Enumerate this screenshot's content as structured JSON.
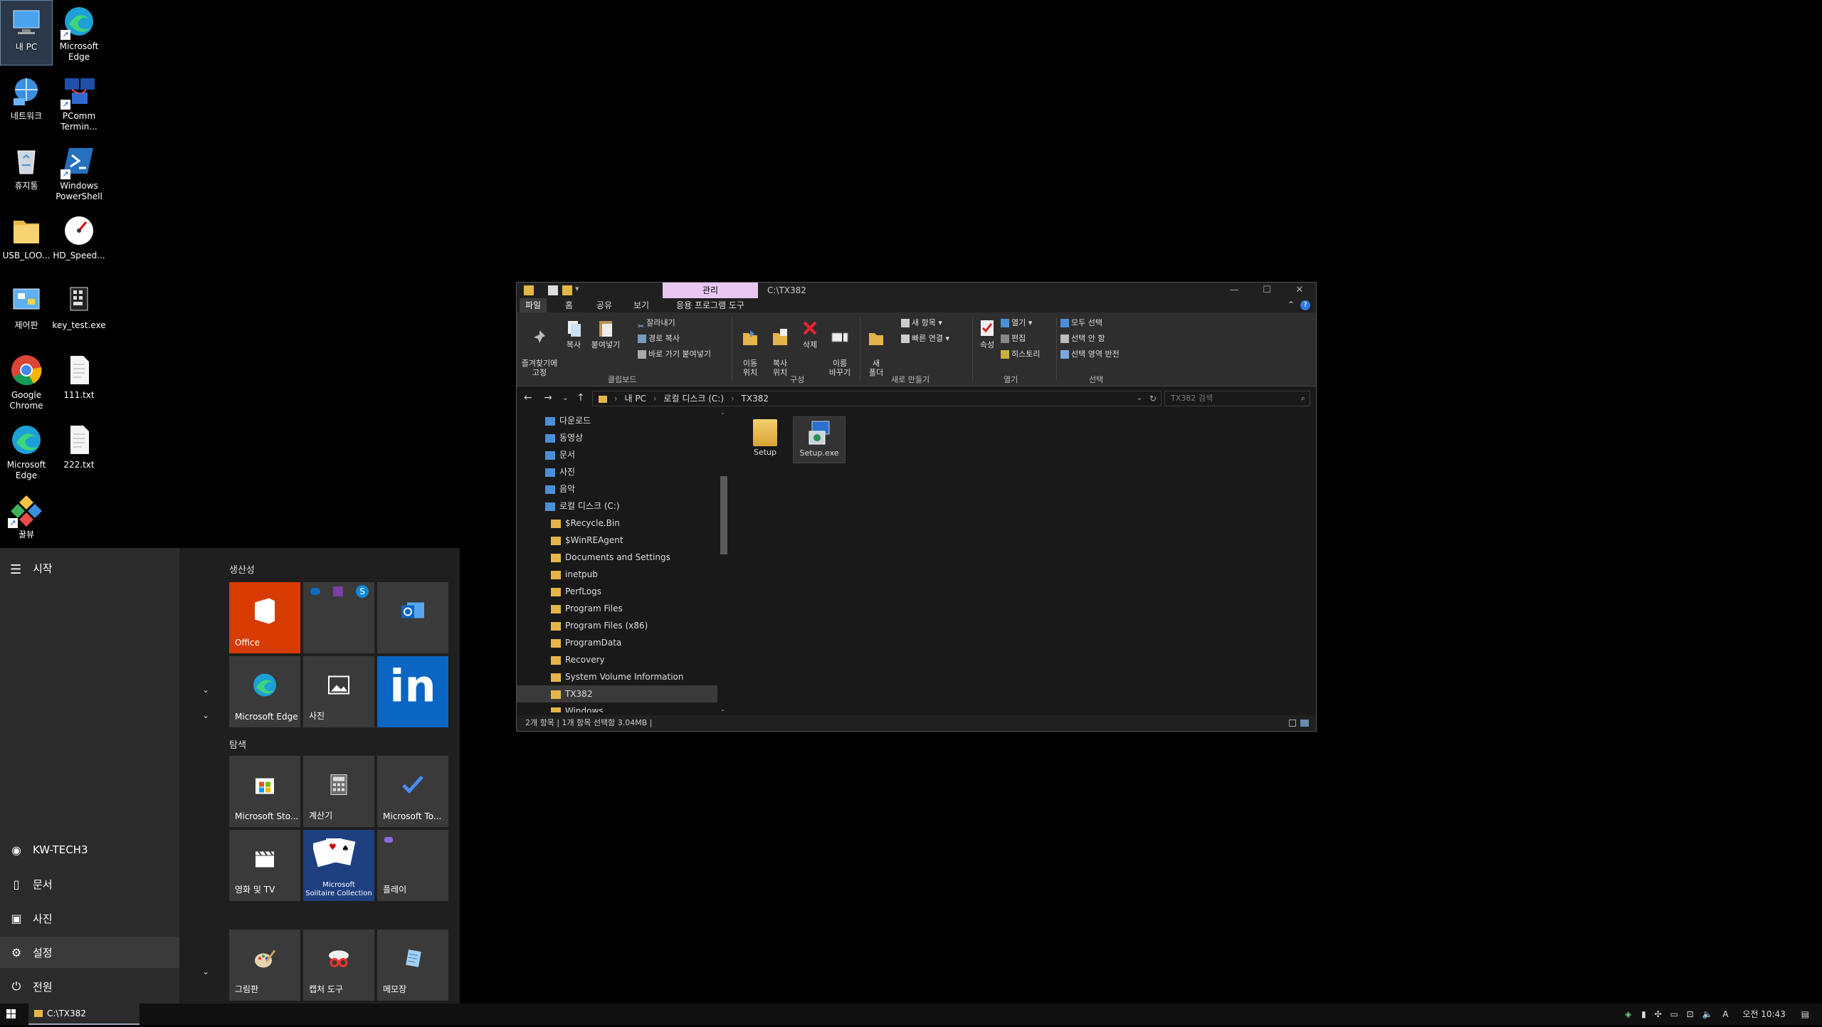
{
  "desktop": {
    "icons": [
      {
        "label": "내 PC",
        "icon": "this-pc-icon"
      },
      {
        "label": "Microsoft\nEdge",
        "icon": "edge-icon"
      },
      {
        "label": "네트워크",
        "icon": "network-icon"
      },
      {
        "label": "PComm\nTermin...",
        "icon": "pcomm-terminal-icon"
      },
      {
        "label": "휴지통",
        "icon": "recycle-bin-icon"
      },
      {
        "label": "Windows\nPowerShell",
        "icon": "powershell-icon"
      },
      {
        "label": "USB_LOO...",
        "icon": "folder-icon"
      },
      {
        "label": "HD_Speed...",
        "icon": "hd-speed-icon"
      },
      {
        "label": "제어판",
        "icon": "control-panel-icon"
      },
      {
        "label": "key_test.exe",
        "icon": "keyboard-app-icon"
      },
      {
        "label": "Google\nChrome",
        "icon": "chrome-icon"
      },
      {
        "label": "111.txt",
        "icon": "text-file-icon"
      },
      {
        "label": "Microsoft\nEdge",
        "icon": "edge-icon"
      },
      {
        "label": "222.txt",
        "icon": "text-file-icon"
      },
      {
        "label": "꿀뷰",
        "icon": "honeyview-icon"
      }
    ]
  },
  "start_menu": {
    "title": "시작",
    "nav": {
      "user": "KW-TECH3",
      "documents": "문서",
      "pictures": "사진",
      "settings": "설정",
      "power": "전원"
    },
    "groups": {
      "productivity": "생산성",
      "explore": "탐색"
    },
    "tiles": {
      "office": "Office",
      "edge": "Microsoft Edge",
      "photos": "사진",
      "store": "Microsoft Sto...",
      "calculator": "계산기",
      "todo": "Microsoft To...",
      "movies": "영화 및 TV",
      "solitaire": "Microsoft\nSolitaire Collection",
      "play": "플레이",
      "paint": "그림판",
      "snipping": "캡처 도구",
      "notepad": "메모장"
    }
  },
  "explorer": {
    "manage_tab": "관리",
    "title": "C:\\TX382",
    "tabs": {
      "file": "파일",
      "home": "홈",
      "share": "공유",
      "view": "보기",
      "app_tools": "응용 프로그램 도구"
    },
    "ribbon": {
      "pin": "즐겨찾기에\n고정",
      "copy": "복사",
      "paste": "붙여넣기",
      "cut": "잘라내기",
      "copy_path": "경로 복사",
      "paste_shortcut": "바로 가기 붙여넣기",
      "clipboard": "클립보드",
      "move_to": "이동\n위치",
      "copy_to": "복사\n위치",
      "delete": "삭제",
      "rename": "이름\n바꾸기",
      "organize": "구성",
      "new_folder": "새\n폴더",
      "new_item": "새 항목",
      "easy_access": "빠른 연결",
      "new": "새로 만들기",
      "properties": "속성",
      "open": "열기",
      "edit": "편집",
      "history": "히스토리",
      "open_group": "열기",
      "select_all": "모두 선택",
      "select_none": "선택 안 함",
      "invert_selection": "선택 영역 반전",
      "select": "선택"
    },
    "address": {
      "crumbs": [
        "내 PC",
        "로컬 디스크 (C:)",
        "TX382"
      ],
      "search_placeholder": "TX382 검색"
    },
    "tree": [
      {
        "label": "다운로드",
        "indent": 1
      },
      {
        "label": "동영상",
        "indent": 1
      },
      {
        "label": "문서",
        "indent": 1
      },
      {
        "label": "사진",
        "indent": 1
      },
      {
        "label": "음악",
        "indent": 1
      },
      {
        "label": "로컬 디스크 (C:)",
        "indent": 1
      },
      {
        "label": "$Recycle.Bin",
        "indent": 2
      },
      {
        "label": "$WinREAgent",
        "indent": 2
      },
      {
        "label": "Documents and Settings",
        "indent": 2
      },
      {
        "label": "inetpub",
        "indent": 2
      },
      {
        "label": "PerfLogs",
        "indent": 2
      },
      {
        "label": "Program Files",
        "indent": 2
      },
      {
        "label": "Program Files (x86)",
        "indent": 2
      },
      {
        "label": "ProgramData",
        "indent": 2
      },
      {
        "label": "Recovery",
        "indent": 2
      },
      {
        "label": "System Volume Information",
        "indent": 2
      },
      {
        "label": "TX382",
        "indent": 2
      },
      {
        "label": "Windows",
        "indent": 2
      }
    ],
    "files": [
      {
        "name": "Setup",
        "type": "folder"
      },
      {
        "name": "Setup.exe",
        "type": "exe"
      }
    ],
    "status": "2개 항목  |  1개 항목 선택함 3.04MB  |"
  },
  "taskbar": {
    "explorer_label": "C:\\TX382",
    "time": "오전 10:43",
    "ime": "A"
  },
  "colors": {
    "accent_manage": "#e8c8f0",
    "office_tile": "#d83b01",
    "linkedin_tile": "#0a66c2",
    "solitaire_tile": "#1e3f80"
  }
}
